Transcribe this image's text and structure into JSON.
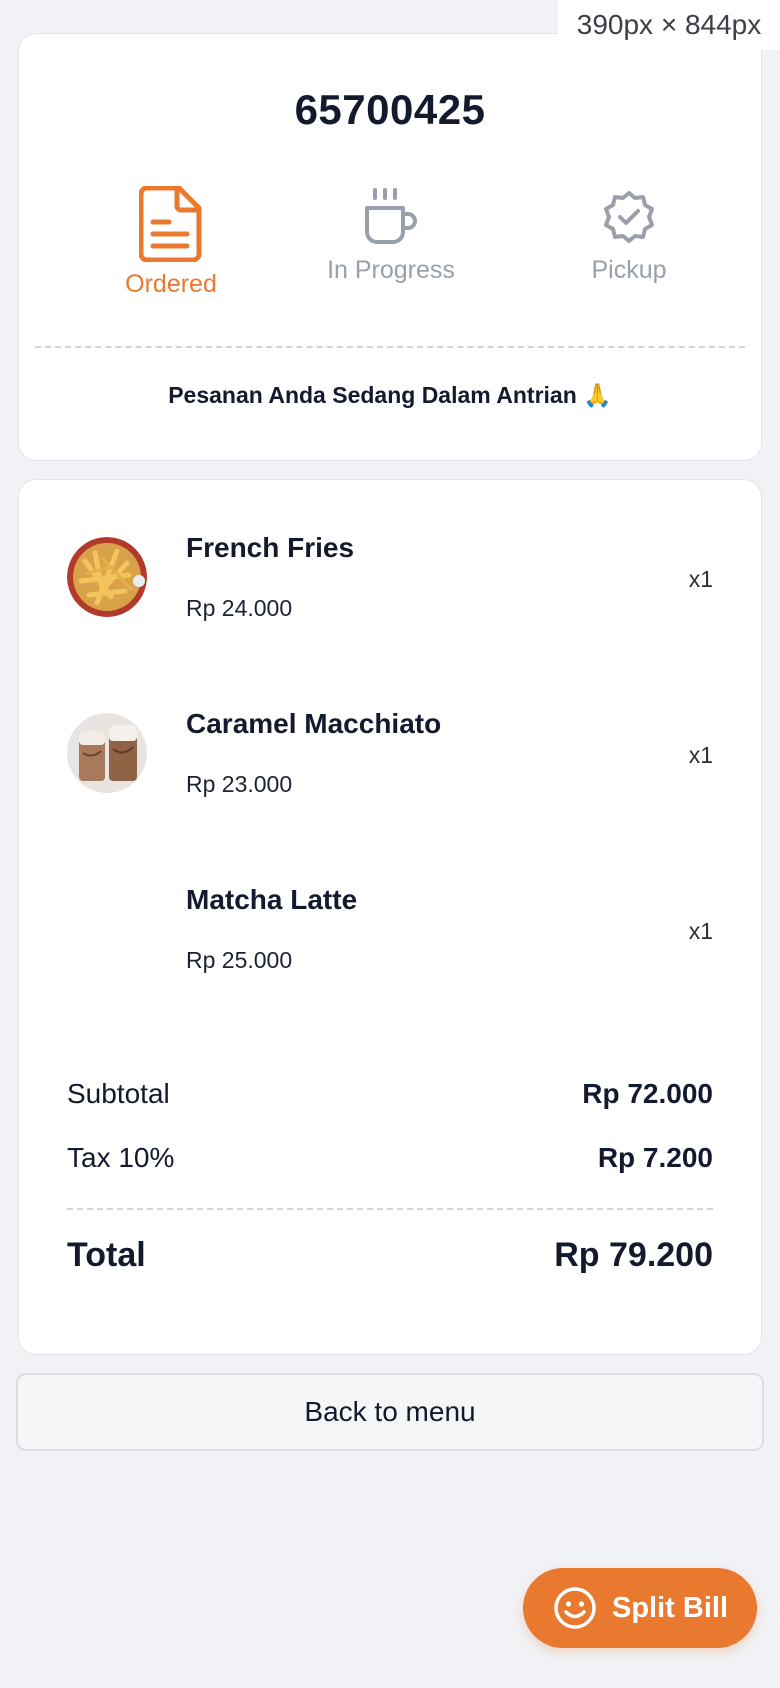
{
  "viewport_badge": "390px × 844px",
  "order": {
    "number": "65700425",
    "status_message": "Pesanan Anda Sedang Dalam Antrian 🙏"
  },
  "steps": [
    {
      "label": "Ordered",
      "icon": "document-icon",
      "state": "active"
    },
    {
      "label": "In Progress",
      "icon": "coffee-cup-icon",
      "state": "inactive"
    },
    {
      "label": "Pickup",
      "icon": "check-badge-icon",
      "state": "inactive"
    }
  ],
  "items": [
    {
      "name": "French Fries",
      "price": "Rp 24.000",
      "qty": "x1",
      "thumbnail": "french-fries-photo"
    },
    {
      "name": "Caramel Macchiato",
      "price": "Rp 23.000",
      "qty": "x1",
      "thumbnail": "caramel-macchiato-photo"
    },
    {
      "name": "Matcha Latte",
      "price": "Rp 25.000",
      "qty": "x1",
      "thumbnail": ""
    }
  ],
  "summary": {
    "subtotal_label": "Subtotal",
    "subtotal_value": "Rp 72.000",
    "tax_label": "Tax 10%",
    "tax_value": "Rp 7.200",
    "total_label": "Total",
    "total_value": "Rp 79.200"
  },
  "actions": {
    "back_label": "Back to menu",
    "split_label": "Split Bill",
    "split_icon": "smiley-icon"
  },
  "colors": {
    "accent": "#e8792f",
    "inactive": "#9aa0ab",
    "background": "#f1f2f5",
    "text": "#141a2e"
  }
}
